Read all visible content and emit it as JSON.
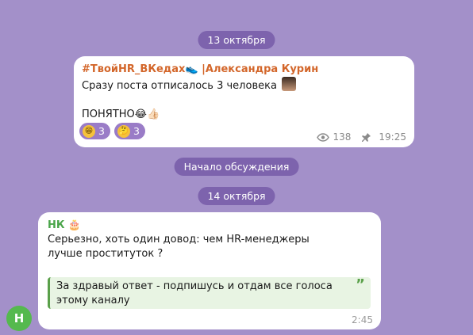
{
  "date_pill_1": "13 октября",
  "post": {
    "channel": "#ТвойHR_ВКедах",
    "channel_icon": "sneaker-icon",
    "author": "|Александра Курин",
    "line1": "Сразу поста отписалось 3 человека",
    "line2": "ПОНЯТНО",
    "line2_emoji": "😂👍🏻",
    "reactions": [
      {
        "emoji": "😁",
        "count": "3"
      },
      {
        "emoji": "🤔",
        "count": "3"
      }
    ],
    "views": "138",
    "time": "19:25"
  },
  "discussion_pill": "Начало обсуждения",
  "date_pill_2": "14 октября",
  "comment": {
    "author": "НК",
    "author_emoji": "🎂",
    "text": "Серьезно, хоть один довод: чем HR-менеджеры лучше проституток ?",
    "quote": "За здравый ответ - подпишусь и отдам все голоса этому каналу",
    "time": "2:45",
    "avatar_letter": "Н"
  },
  "colors": {
    "background": "#a390c9",
    "pill": "#7d63ad",
    "channel_name": "#d3662a",
    "author_name": "#4aa54a",
    "avatar": "#55b94e"
  }
}
